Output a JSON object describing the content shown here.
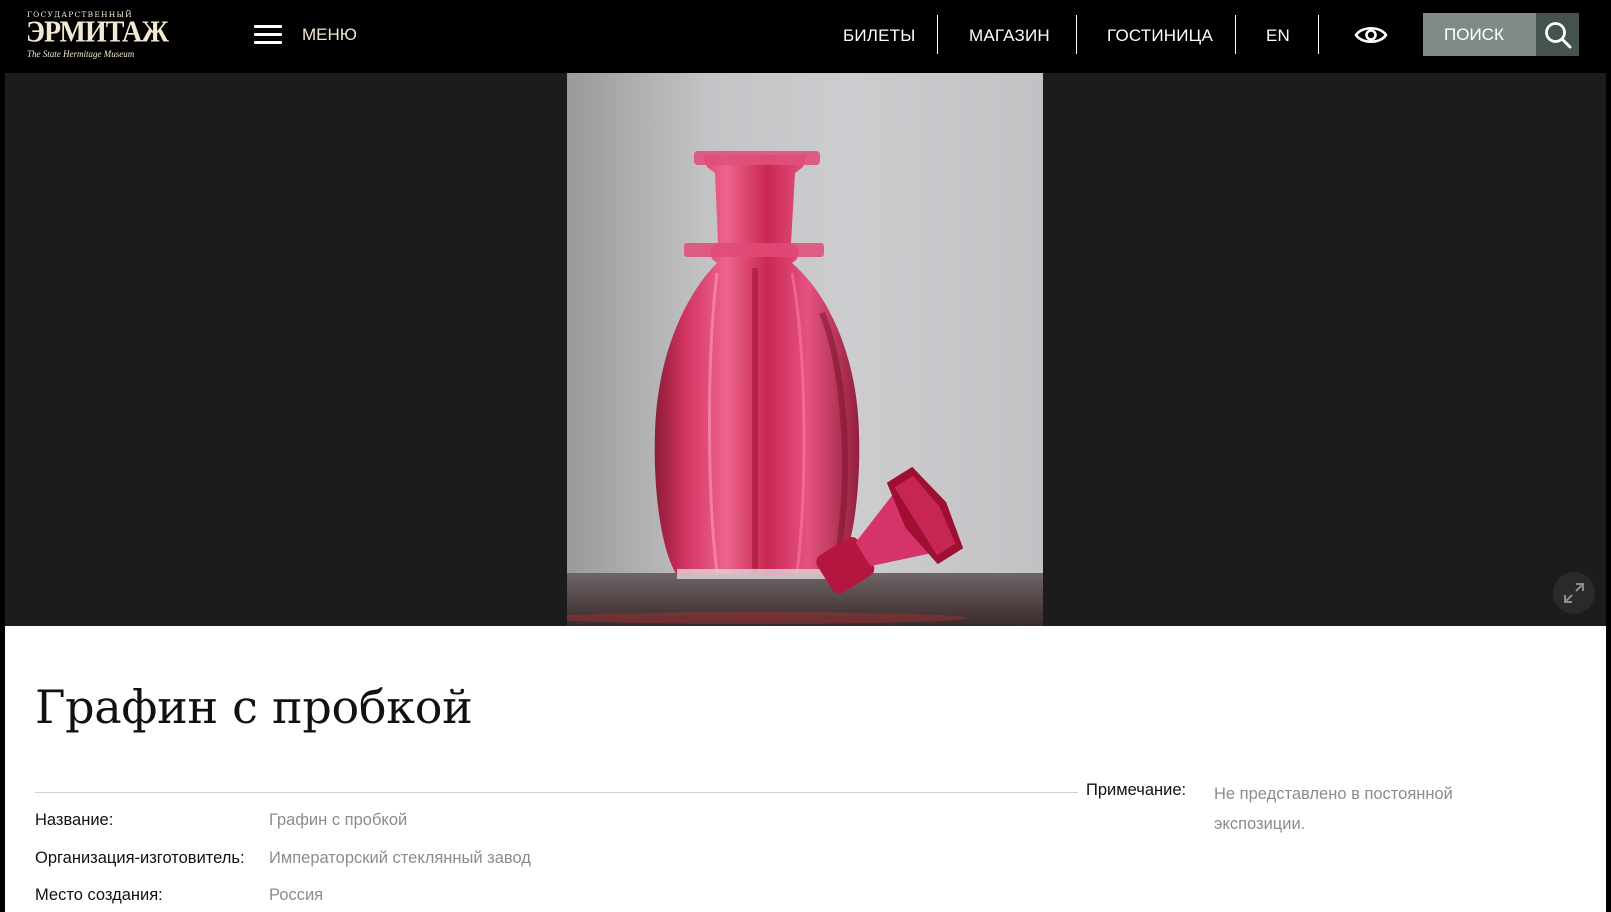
{
  "header": {
    "logo": {
      "top_text": "ГОСУДАРСТВЕННЫЙ",
      "main_text": "ЭРМИТАЖ",
      "sub_text": "The State Hermitage Museum"
    },
    "menu_label": "МЕНЮ",
    "nav": [
      {
        "label": "БИЛЕТЫ"
      },
      {
        "label": "МАГАЗИН"
      },
      {
        "label": "ГОСТИНИЦА"
      },
      {
        "label": "EN"
      }
    ],
    "search_label": "ПОИСК"
  },
  "gallery": {
    "image_alt": "Графин с пробкой"
  },
  "object": {
    "title": "Графин с пробкой",
    "properties": [
      {
        "label": "Название:",
        "value": "Графин с пробкой"
      },
      {
        "label": "Организация-изготовитель:",
        "value": "Императорский стеклянный завод"
      },
      {
        "label": "Место создания:",
        "value": "Россия"
      }
    ],
    "note": {
      "label": "Примечание:",
      "value": "Не представлено в постоянной экспозиции."
    }
  },
  "colors": {
    "header_bg": "#000000",
    "gallery_bg": "#1c1c1c",
    "search_bg": "#7f8b84",
    "search_btn_bg": "#44534b",
    "glass_red": "#c41a48"
  }
}
